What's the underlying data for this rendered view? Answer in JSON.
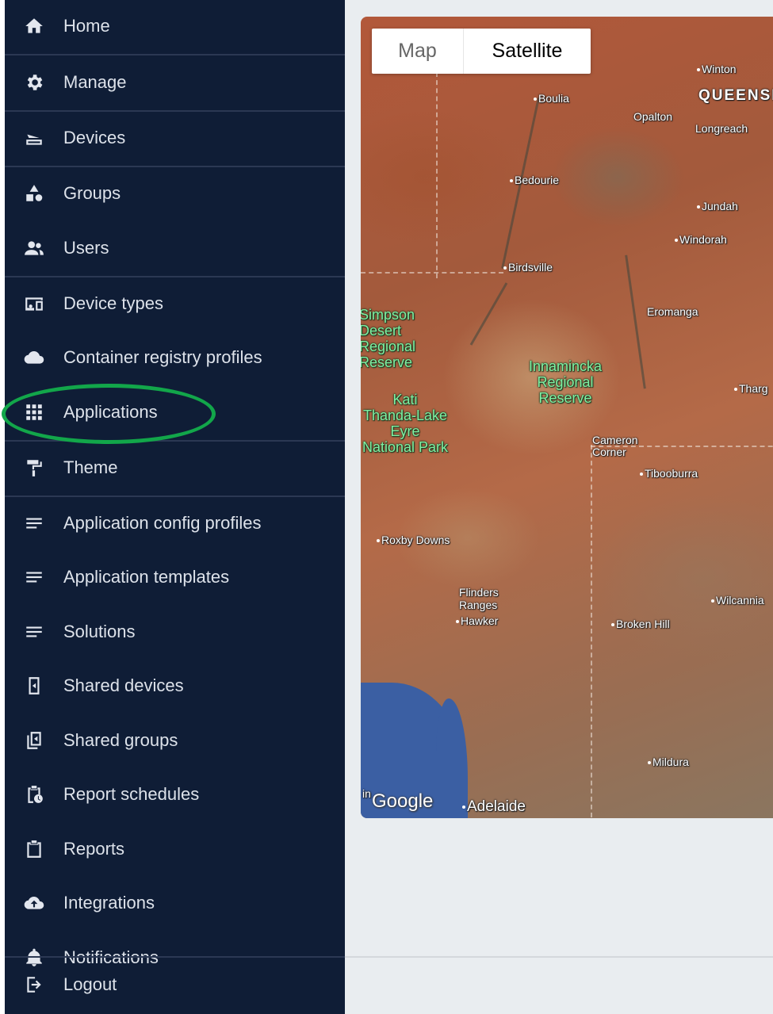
{
  "sidebar": {
    "items": [
      {
        "label": "Home",
        "icon": "home-icon"
      },
      {
        "label": "Manage",
        "icon": "gear-icon"
      },
      {
        "label": "Devices",
        "icon": "router-icon"
      },
      {
        "label": "Groups",
        "icon": "shapes-icon"
      },
      {
        "label": "Users",
        "icon": "users-icon"
      },
      {
        "label": "Device types",
        "icon": "devices-icon"
      },
      {
        "label": "Container registry profiles",
        "icon": "cloud-icon"
      },
      {
        "label": "Applications",
        "icon": "apps-grid-icon"
      },
      {
        "label": "Theme",
        "icon": "paint-roller-icon"
      },
      {
        "label": "Application config profiles",
        "icon": "lines-icon"
      },
      {
        "label": "Application templates",
        "icon": "lines-icon"
      },
      {
        "label": "Solutions",
        "icon": "lines-icon"
      },
      {
        "label": "Shared devices",
        "icon": "shared-device-icon"
      },
      {
        "label": "Shared groups",
        "icon": "shared-group-icon"
      },
      {
        "label": "Report schedules",
        "icon": "clipboard-clock-icon"
      },
      {
        "label": "Reports",
        "icon": "clipboard-icon"
      },
      {
        "label": "Integrations",
        "icon": "cloud-upload-icon"
      },
      {
        "label": "Notifications",
        "icon": "bell-icon"
      },
      {
        "label": "Logout",
        "icon": "logout-icon"
      }
    ],
    "highlighted_item": "Applications",
    "highlight_color": "#12a64a",
    "background_color": "#0f1d36"
  },
  "map": {
    "type_control": {
      "map_label": "Map",
      "satellite_label": "Satellite",
      "selected": "Satellite"
    },
    "places": {
      "winton": "Winton",
      "queensland": "QUEENSL",
      "boulia": "Boulia",
      "opalton": "Opalton",
      "longreach": "Longreach",
      "bedourie": "Bedourie",
      "jundah": "Jundah",
      "windorah": "Windorah",
      "birdsville": "Birdsville",
      "eromanga": "Eromanga",
      "q_partial": "Q",
      "thargo": "Tharg",
      "cameron_corner": "Cameron\nCorner",
      "tibooburra": "Tibooburra",
      "roxby_downs": "Roxby Downs",
      "flinders_ranges": "Flinders\nRanges",
      "hawker": "Hawker",
      "wilcannia": "Wilcannia",
      "broken_hill": "Broken Hill",
      "mildura": "Mildura",
      "adelaide": "Adelaide",
      "partial_bottom": "in"
    },
    "parks": {
      "simpson": "Simpson\nDesert\nRegional\nReserve",
      "innamincka": "Innamincka\nRegional\nReserve",
      "kati_thanda": "Kati\nThanda-Lake\nEyre\nNational Park"
    },
    "attribution": "Google"
  }
}
